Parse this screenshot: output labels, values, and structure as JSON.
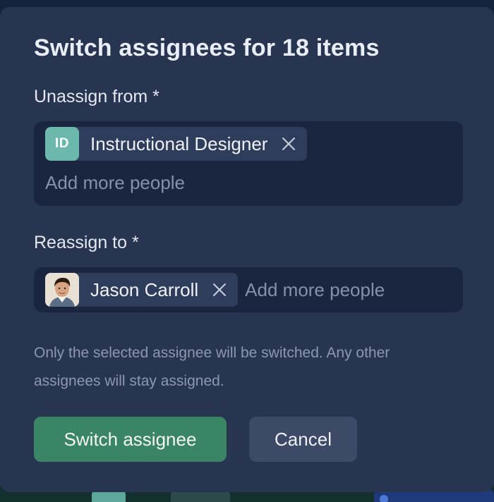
{
  "dialog": {
    "title": "Switch assignees for 18 items",
    "unassign": {
      "label": "Unassign from *",
      "chips": [
        {
          "initials": "ID",
          "name": "Instructional Designer",
          "avatar_color": "#6cb8ad",
          "remove_icon": "close-icon"
        }
      ],
      "placeholder": "Add more people"
    },
    "reassign": {
      "label": "Reassign to *",
      "chips": [
        {
          "name": "Jason Carroll",
          "avatar": "user-photo",
          "remove_icon": "close-icon"
        }
      ],
      "placeholder": "Add more people"
    },
    "hint": "Only the selected assignee will be switched. Any other assignees will stay assigned.",
    "buttons": {
      "primary": "Switch assignee",
      "secondary": "Cancel"
    }
  },
  "colors": {
    "dialog_bg": "#283550",
    "field_bg": "#1a2540",
    "chip_bg": "#2f3d5c",
    "primary_button": "#3a8566",
    "secondary_button": "#3c4a68"
  }
}
